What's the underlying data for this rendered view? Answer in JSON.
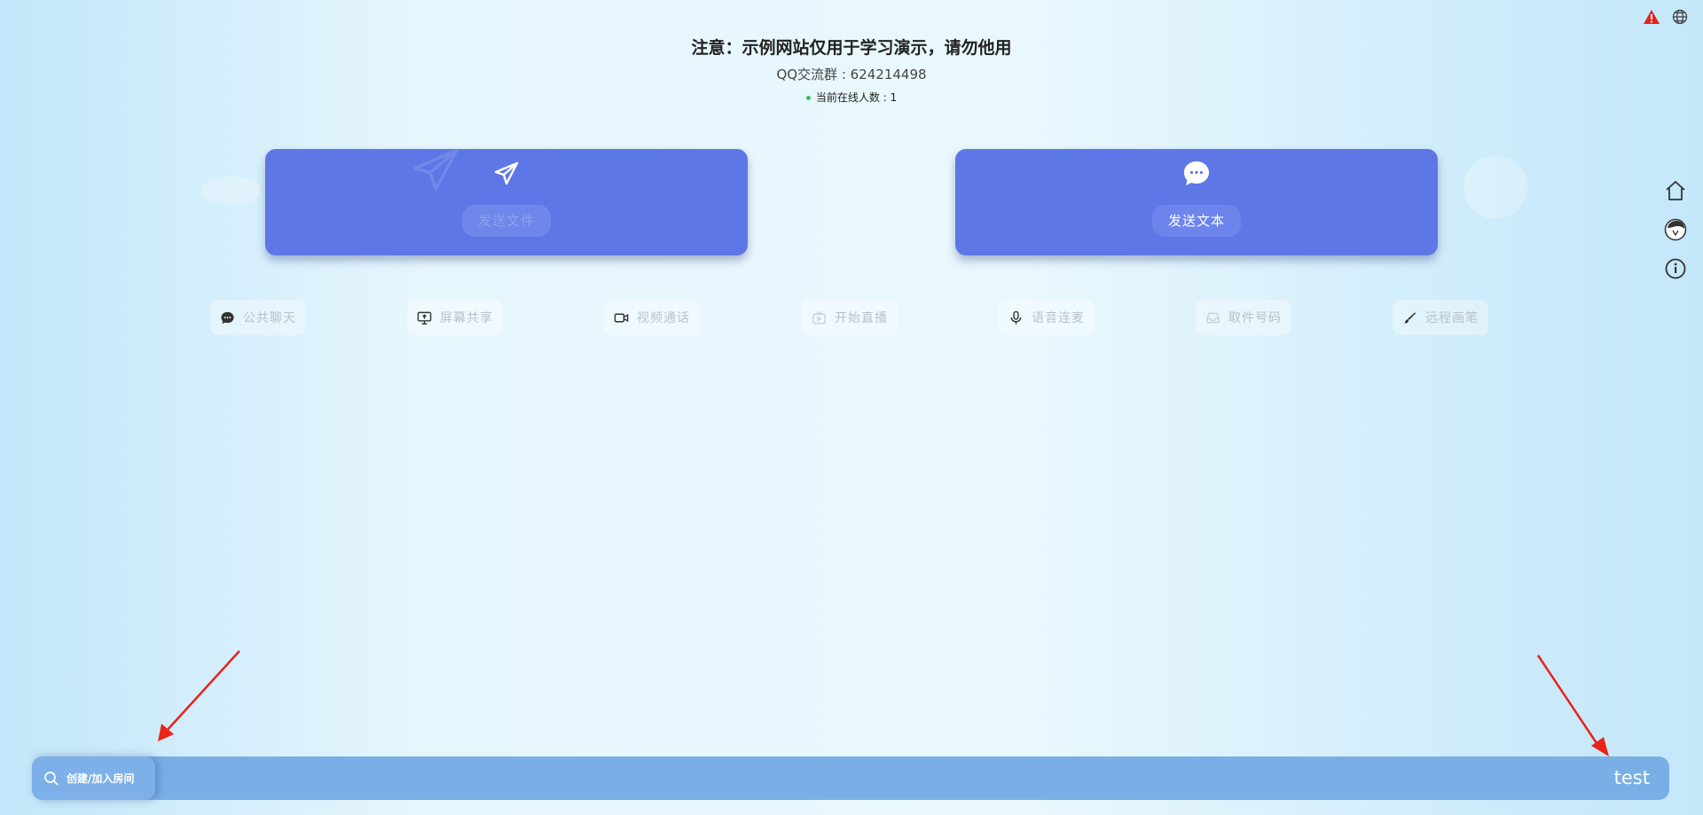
{
  "header": {
    "notice": "注意：示例网站仅用于学习演示，请勿他用",
    "qq_group": "QQ交流群 : 624214498",
    "online_count": "当前在线人数 : 1"
  },
  "cards": {
    "send_file_label": "发送文件",
    "send_text_label": "发送文本"
  },
  "toolbar": {
    "items": [
      {
        "label": "公共聊天",
        "icon": "chat-bubble-icon"
      },
      {
        "label": "屏幕共享",
        "icon": "screen-share-icon"
      },
      {
        "label": "视频通话",
        "icon": "video-camera-icon"
      },
      {
        "label": "开始直播",
        "icon": "tv-live-icon"
      },
      {
        "label": "语音连麦",
        "icon": "microphone-icon"
      },
      {
        "label": "取件号码",
        "icon": "inbox-icon"
      },
      {
        "label": "远程画笔",
        "icon": "brush-icon"
      }
    ]
  },
  "topbar": {
    "icons": [
      "warning-icon",
      "globe-icon"
    ]
  },
  "side_nav": {
    "icons": [
      "home-icon",
      "user-avatar-icon",
      "info-icon"
    ]
  },
  "bottom": {
    "room_button_label": "创建/加入房间",
    "room_name": "test"
  },
  "colors": {
    "card": "#5e77e6",
    "bar": "#79afe6",
    "warning": "#e0271d",
    "online_dot": "#36c25a"
  }
}
